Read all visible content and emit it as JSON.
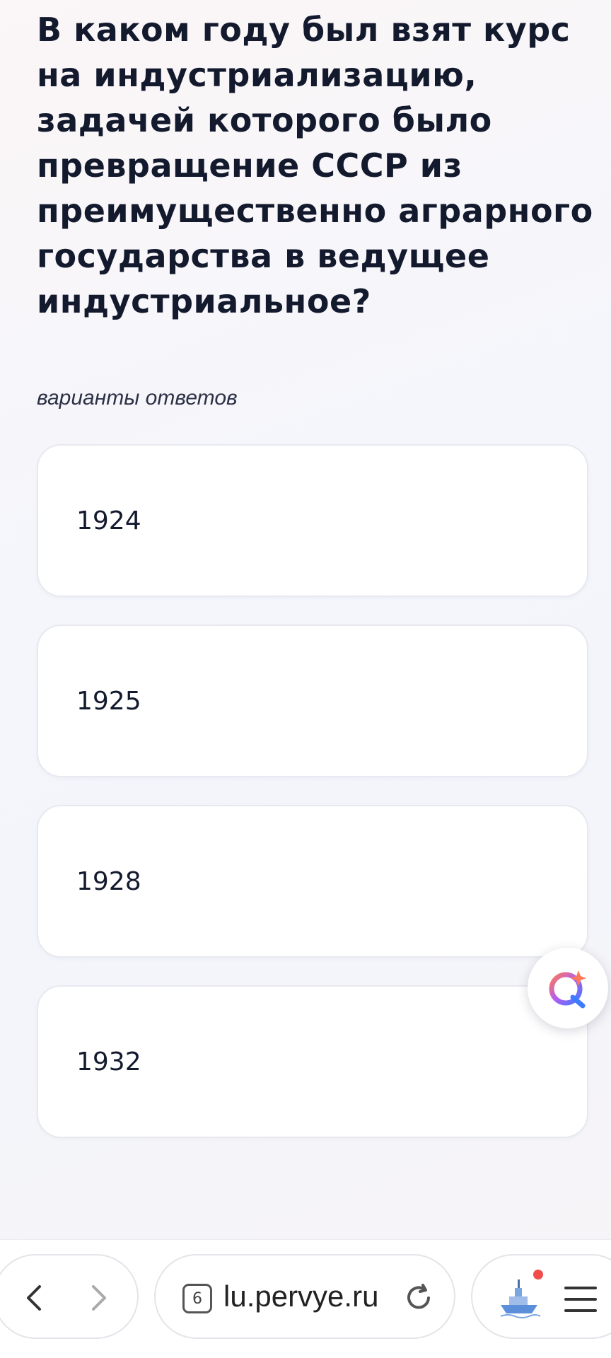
{
  "question": {
    "text": "В каком году был взят курс на индустриализацию, задачей которого было превращение СССР из преимущественно аграрного государства в ведущее индустриальное?"
  },
  "answers_caption": "варианты ответов",
  "answers": [
    {
      "label": "1924"
    },
    {
      "label": "1925"
    },
    {
      "label": "1928"
    },
    {
      "label": "1932"
    }
  ],
  "fab": {
    "icon": "assistant-q-icon"
  },
  "browser": {
    "tab_count": "6",
    "url": "lu.pervye.ru",
    "icons": [
      "back-icon",
      "forward-icon",
      "reload-icon",
      "ship-avatar-icon",
      "menu-icon"
    ],
    "notification_color": "#f24b4b"
  }
}
